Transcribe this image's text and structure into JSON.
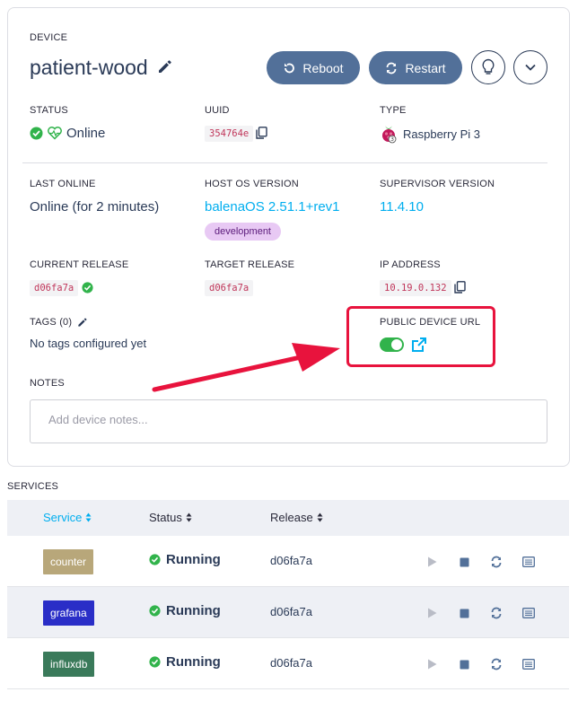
{
  "device": {
    "section_label": "DEVICE",
    "name": "patient-wood",
    "buttons": {
      "reboot": "Reboot",
      "restart": "Restart"
    },
    "status": {
      "label": "STATUS",
      "value": "Online"
    },
    "uuid": {
      "label": "UUID",
      "value": "354764e"
    },
    "type": {
      "label": "TYPE",
      "value": "Raspberry Pi 3"
    },
    "last_online": {
      "label": "LAST ONLINE",
      "value": "Online (for 2 minutes)"
    },
    "host_os": {
      "label": "HOST OS VERSION",
      "value": "balenaOS 2.51.1+rev1",
      "badge": "development"
    },
    "supervisor": {
      "label": "SUPERVISOR VERSION",
      "value": "11.4.10"
    },
    "current_release": {
      "label": "CURRENT RELEASE",
      "value": "d06fa7a"
    },
    "target_release": {
      "label": "TARGET RELEASE",
      "value": "d06fa7a"
    },
    "ip_address": {
      "label": "IP ADDRESS",
      "value": "10.19.0.132"
    },
    "tags": {
      "label": "TAGS (0)",
      "empty": "No tags configured yet"
    },
    "public_url": {
      "label": "PUBLIC DEVICE URL",
      "enabled": true
    },
    "notes": {
      "label": "NOTES",
      "placeholder": "Add device notes..."
    }
  },
  "services": {
    "label": "SERVICES",
    "columns": [
      "Service",
      "Status",
      "Release"
    ],
    "rows": [
      {
        "name": "counter",
        "color": "#b8a77a",
        "status": "Running",
        "release": "d06fa7a"
      },
      {
        "name": "grafana",
        "color": "#2a2ec7",
        "status": "Running",
        "release": "d06fa7a"
      },
      {
        "name": "influxdb",
        "color": "#3a7a5a",
        "status": "Running",
        "release": "d06fa7a"
      }
    ]
  },
  "colors": {
    "accent": "#00aeef",
    "button": "#527099",
    "success": "#31b34b",
    "highlight": "#e8133d"
  }
}
